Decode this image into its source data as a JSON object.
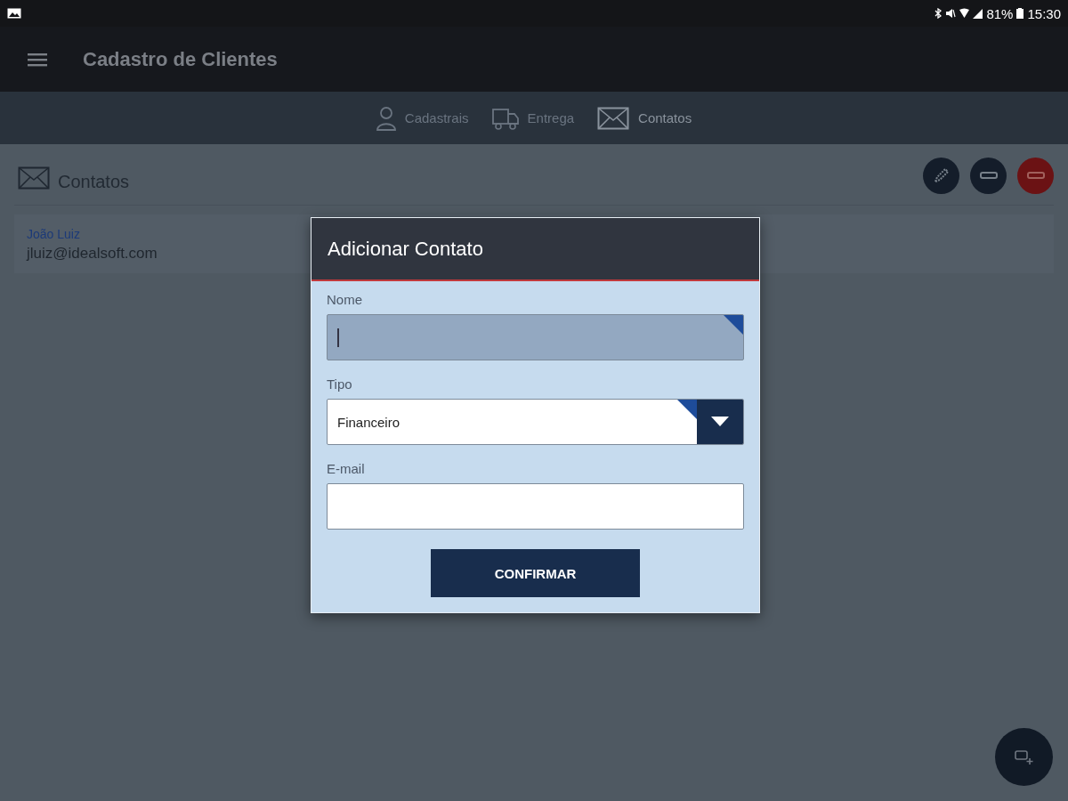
{
  "status_bar": {
    "battery": "81%",
    "time": "15:30"
  },
  "app_bar": {
    "title": "Cadastro de Clientes"
  },
  "tabs": [
    {
      "label": "Cadastrais",
      "selected": false
    },
    {
      "label": "Entrega",
      "selected": false
    },
    {
      "label": "Contatos",
      "selected": true
    }
  ],
  "section": {
    "title": "Contatos"
  },
  "contacts": [
    {
      "name": "João Luiz",
      "email": "jluiz@idealsoft.com"
    }
  ],
  "dialog": {
    "title": "Adicionar Contato",
    "fields": [
      {
        "kind": "text",
        "label": "Nome",
        "focused": true,
        "required": true
      },
      {
        "kind": "select",
        "label": "Tipo",
        "value": "Financeiro",
        "focused": false,
        "required": true
      },
      {
        "kind": "text",
        "label": "E-mail",
        "focused": false,
        "required": false
      }
    ],
    "button": "CONFIRMAR"
  }
}
